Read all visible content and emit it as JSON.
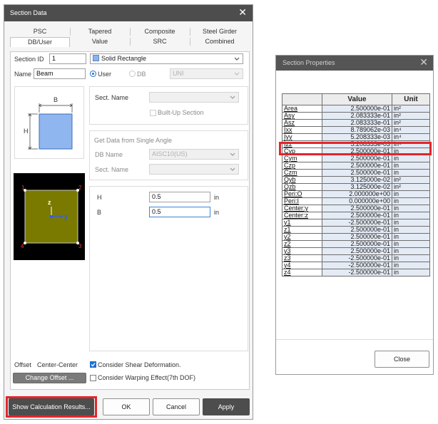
{
  "section_data": {
    "title": "Section Data",
    "tabs_row1": [
      "PSC",
      "Tapered",
      "Composite",
      "Steel Girder"
    ],
    "tabs_row2": [
      "DB/User",
      "Value",
      "SRC",
      "Combined"
    ],
    "section_id_label": "Section ID",
    "section_id_value": "1",
    "shape_value": "Solid Rectangle",
    "name_label": "Name",
    "name_value": "Beam",
    "radio_user": "User",
    "radio_db": "DB",
    "db_value": "UNI",
    "sect_name_label": "Sect. Name",
    "built_up_label": "Built-Up Section",
    "single_angle_header": "Get Data from Single Angle",
    "db_name_label": "DB Name",
    "db_name_value": "AISC10(US)",
    "sect_name2_label": "Sect. Name",
    "diagram": {
      "b_label": "B",
      "h_label": "H",
      "z_label": "z",
      "y_label": "y",
      "corners": [
        "1",
        "2",
        "3",
        "4"
      ]
    },
    "h_label": "H",
    "h_value": "0.5",
    "h_unit": "in",
    "b_label": "B",
    "b_value": "0.5",
    "b_unit": "in",
    "offset_label": "Offset",
    "offset_value": "Center-Center",
    "change_offset_label": "Change Offset ...",
    "consider_shear_label": "Consider Shear Deformation.",
    "consider_warping_label": "Consider Warping Effect(7th DOF)",
    "show_calc_label": "Show Calculation Results...",
    "ok_label": "OK",
    "cancel_label": "Cancel",
    "apply_label": "Apply"
  },
  "section_properties": {
    "title": "Section Properties",
    "columns": [
      "",
      "Value",
      "Unit"
    ],
    "rows": [
      [
        "Area",
        "2.500000e-01",
        "in²"
      ],
      [
        "Asy",
        "2.083333e-01",
        "in²"
      ],
      [
        "Asz",
        "2.083333e-01",
        "in²"
      ],
      [
        "Ixx",
        "8.789062e-03",
        "in⁴"
      ],
      [
        "Iyy",
        "5.208333e-03",
        "in⁴"
      ],
      [
        "Izz",
        "5.208333e-03",
        "in⁴"
      ],
      [
        "Cyp",
        "2.500000e-01",
        "in"
      ],
      [
        "Cym",
        "2.500000e-01",
        "in"
      ],
      [
        "Czp",
        "2.500000e-01",
        "in"
      ],
      [
        "Czm",
        "2.500000e-01",
        "in"
      ],
      [
        "Qyb",
        "3.125000e-02",
        "in²"
      ],
      [
        "Qzb",
        "3.125000e-02",
        "in²"
      ],
      [
        "Peri:O",
        "2.000000e+00",
        "in"
      ],
      [
        "Peri:I",
        "0.000000e+00",
        "in"
      ],
      [
        "Center:y",
        "2.500000e-01",
        "in"
      ],
      [
        "Center:z",
        "2.500000e-01",
        "in"
      ],
      [
        "y1",
        "-2.500000e-01",
        "in"
      ],
      [
        "z1",
        "2.500000e-01",
        "in"
      ],
      [
        "y2",
        "2.500000e-01",
        "in"
      ],
      [
        "z2",
        "2.500000e-01",
        "in"
      ],
      [
        "y3",
        "2.500000e-01",
        "in"
      ],
      [
        "z3",
        "-2.500000e-01",
        "in"
      ],
      [
        "y4",
        "-2.500000e-01",
        "in"
      ],
      [
        "z4",
        "-2.500000e-01",
        "in"
      ]
    ],
    "close_label": "Close"
  },
  "colors": {
    "title_bar": "#4d4d4d",
    "highlight": "#e0262c",
    "accent": "#1f6fd0",
    "section_fill": "#7a7a00"
  }
}
